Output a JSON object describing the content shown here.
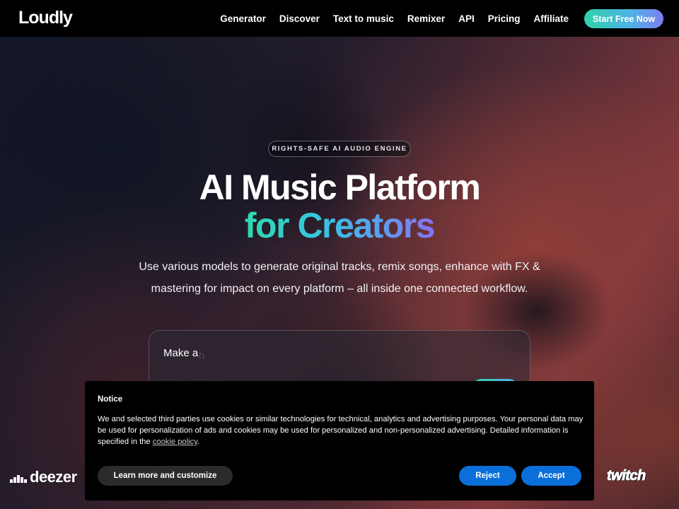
{
  "nav": {
    "logo": "Loudly",
    "links": [
      "Generator",
      "Discover",
      "Text to music",
      "Remixer",
      "API",
      "Pricing",
      "Affiliate"
    ],
    "cta": "Start Free Now"
  },
  "hero": {
    "badge": "RIGHTS-SAFE AI AUDIO ENGINE",
    "title_line1": "AI Music Platform",
    "title_line2": "for Creators",
    "subtitle": "Use various models to generate original tracks, remix songs, enhance with FX & mastering for impact on every platform – all inside one connected workflow."
  },
  "prompt": {
    "text": "Make a",
    "ghost": "h"
  },
  "partners": {
    "left": "deezer",
    "right": "twitch"
  },
  "cookie": {
    "title": "Notice",
    "body_before_link": "We and selected third parties use cookies or similar technologies for technical, analytics and advertising purposes. Your personal data may be used for personalization of ads and cookies may be used for personalized and non-personalized advertising. Detailed information is specified in the ",
    "link_text": "cookie policy",
    "body_after_link": ".",
    "customize_label": "Learn more and customize",
    "reject_label": "Reject",
    "accept_label": "Accept"
  },
  "colors": {
    "accent_teal": "#2fd3a8",
    "accent_violet": "#8a6ff0",
    "cookie_button_blue": "#0b6fd9"
  }
}
